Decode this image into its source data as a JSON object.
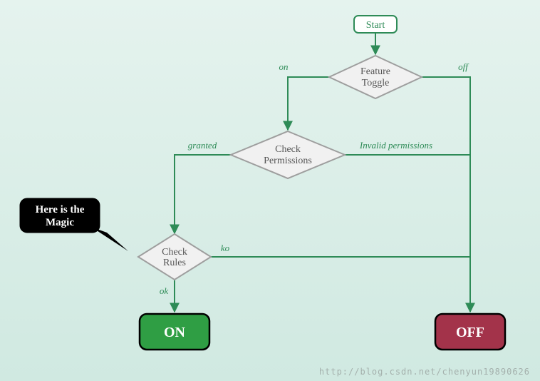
{
  "chart_data": {
    "type": "flowchart",
    "nodes": [
      {
        "id": "start",
        "label": "Start",
        "kind": "start"
      },
      {
        "id": "toggle",
        "label": "Feature\nToggle",
        "kind": "decision"
      },
      {
        "id": "perm",
        "label": "Check\nPermissions",
        "kind": "decision"
      },
      {
        "id": "rules",
        "label": "Check\nRules",
        "kind": "decision"
      },
      {
        "id": "on",
        "label": "ON",
        "kind": "terminal-on"
      },
      {
        "id": "off",
        "label": "OFF",
        "kind": "terminal-off"
      }
    ],
    "edges": [
      {
        "from": "start",
        "to": "toggle",
        "label": ""
      },
      {
        "from": "toggle",
        "to": "perm",
        "label": "on"
      },
      {
        "from": "toggle",
        "to": "off",
        "label": "off"
      },
      {
        "from": "perm",
        "to": "rules",
        "label": "granted"
      },
      {
        "from": "perm",
        "to": "off",
        "label": "Invalid permissions"
      },
      {
        "from": "rules",
        "to": "on",
        "label": "ok"
      },
      {
        "from": "rules",
        "to": "off",
        "label": "ko"
      }
    ],
    "callout": {
      "target": "rules",
      "text": "Here is the\nMagic"
    }
  },
  "labels": {
    "start": "Start",
    "toggle_l1": "Feature",
    "toggle_l2": "Toggle",
    "perm_l1": "Check",
    "perm_l2": "Permissions",
    "rules_l1": "Check",
    "rules_l2": "Rules",
    "on": "ON",
    "off": "OFF",
    "edge_on": "on",
    "edge_off": "off",
    "edge_granted": "granted",
    "edge_invalid": "Invalid permissions",
    "edge_ok": "ok",
    "edge_ko": "ko",
    "callout_l1": "Here is the",
    "callout_l2": "Magic"
  },
  "watermark": "http://blog.csdn.net/chenyun19890626"
}
